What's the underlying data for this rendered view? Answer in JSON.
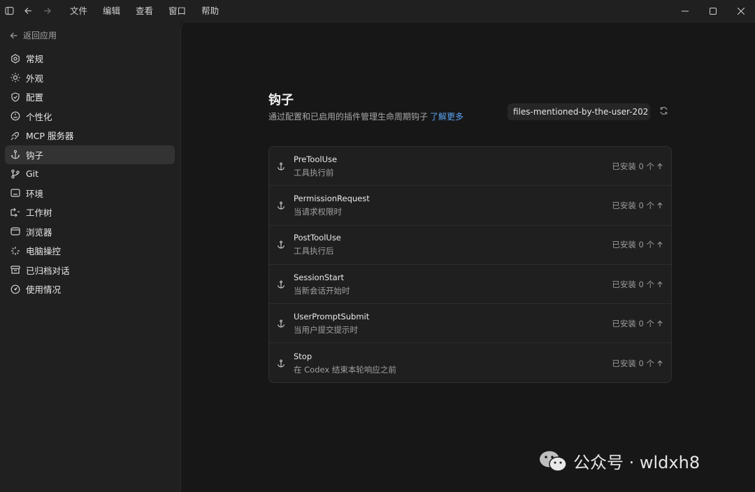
{
  "titlebar": {
    "menu": [
      "文件",
      "编辑",
      "查看",
      "窗口",
      "帮助"
    ],
    "icons": [
      "sidebar-toggle-icon",
      "back-arrow-icon",
      "forward-arrow-icon"
    ],
    "window_controls": [
      "minimize-icon",
      "maximize-icon",
      "close-icon"
    ]
  },
  "sidebar": {
    "back_label": "返回应用",
    "items": [
      {
        "label": "常规",
        "icon": "gear-icon"
      },
      {
        "label": "外观",
        "icon": "sun-icon"
      },
      {
        "label": "配置",
        "icon": "shield-icon"
      },
      {
        "label": "个性化",
        "icon": "smile-icon"
      },
      {
        "label": "MCP 服务器",
        "icon": "plug-icon"
      },
      {
        "label": "钩子",
        "icon": "anchor-icon",
        "active": true
      },
      {
        "label": "Git",
        "icon": "git-branch-icon"
      },
      {
        "label": "环境",
        "icon": "terminal-icon"
      },
      {
        "label": "工作树",
        "icon": "worktree-icon"
      },
      {
        "label": "浏览器",
        "icon": "browser-icon"
      },
      {
        "label": "电脑操控",
        "icon": "sparkle-icon"
      },
      {
        "label": "已归档对话",
        "icon": "archive-icon"
      },
      {
        "label": "使用情况",
        "icon": "gauge-icon"
      }
    ]
  },
  "main": {
    "title": "钩子",
    "subtitle": "通过配置和已启用的插件管理生命周期钩子",
    "learn_more": "了解更多",
    "selector_value": "files-mentioned-by-the-user-202",
    "hooks": [
      {
        "name": "PreToolUse",
        "desc": "工具执行前",
        "status": "已安装 0 个"
      },
      {
        "name": "PermissionRequest",
        "desc": "当请求权限时",
        "status": "已安装 0 个"
      },
      {
        "name": "PostToolUse",
        "desc": "工具执行后",
        "status": "已安装 0 个"
      },
      {
        "name": "SessionStart",
        "desc": "当新会话开始时",
        "status": "已安装 0 个"
      },
      {
        "name": "UserPromptSubmit",
        "desc": "当用户提交提示时",
        "status": "已安装 0 个"
      },
      {
        "name": "Stop",
        "desc": "在 Codex 结束本轮响应之前",
        "status": "已安装 0 个"
      }
    ]
  },
  "watermark": {
    "text": "公众号 · wldxh8"
  },
  "colors": {
    "accent_link": "#5aa4f3",
    "background": "#171717",
    "sidebar": "#202020"
  }
}
